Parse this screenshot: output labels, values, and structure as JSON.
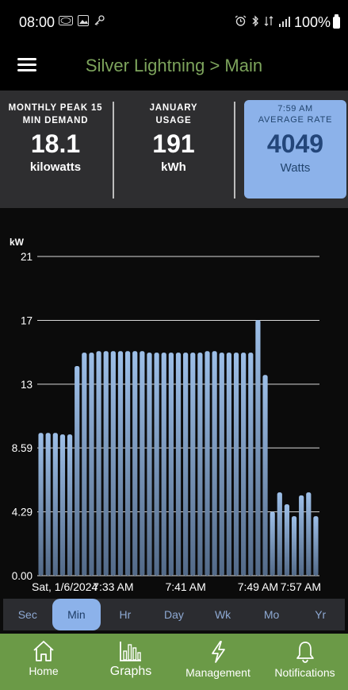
{
  "status_bar": {
    "time": "08:00",
    "battery_text": "100%",
    "left_icons": [
      "ford-notification-icon",
      "image-icon",
      "key-icon"
    ],
    "right_icons": [
      "alarm-icon",
      "bluetooth-icon",
      "data-icon",
      "signal-icon",
      "battery-icon"
    ]
  },
  "app": {
    "title": "Silver Lightning > Main"
  },
  "stats": {
    "peak": {
      "label_line1": "MONTHLY PEAK 15",
      "label_line2": "MIN DEMAND",
      "value": "18.1",
      "unit": "kilowatts"
    },
    "usage": {
      "label_line1": "JANUARY",
      "label_line2": "USAGE",
      "value": "191",
      "unit": "kWh"
    },
    "rate": {
      "time": "7:59 AM",
      "label": "AVERAGE RATE",
      "value": "4049",
      "unit": "Watts"
    }
  },
  "chart_data": {
    "type": "bar",
    "ylabel": "kW",
    "ylim": [
      0,
      21
    ],
    "yticks": [
      "0.00",
      "4.29",
      "8.59",
      "13",
      "17",
      "21"
    ],
    "ytick_values": [
      0,
      4.29,
      8.59,
      12.88,
      17.17,
      21.47
    ],
    "xtick_labels": [
      "Sat, 1/6/2024",
      "7:33 AM",
      "7:41 AM",
      "7:49 AM",
      "7:57 AM"
    ],
    "xtick_positions": [
      0,
      10,
      20,
      30,
      39
    ],
    "values": [
      9.6,
      9.6,
      9.6,
      9.5,
      9.5,
      14.1,
      15.0,
      15.0,
      15.1,
      15.1,
      15.1,
      15.1,
      15.1,
      15.1,
      15.1,
      15.0,
      15.0,
      15.0,
      15.0,
      15.0,
      15.0,
      15.0,
      15.0,
      15.1,
      15.1,
      15.0,
      15.0,
      15.0,
      15.0,
      15.0,
      17.2,
      13.5,
      4.3,
      5.6,
      4.8,
      4.0,
      5.4,
      5.6,
      4.0
    ],
    "bar_color": "#9dbfe8"
  },
  "tabs": {
    "items": [
      "Sec",
      "Min",
      "Hr",
      "Day",
      "Wk",
      "Mo",
      "Yr"
    ],
    "active": "Min"
  },
  "bottom_nav": {
    "items": [
      {
        "label": "Home",
        "icon": "home-icon"
      },
      {
        "label": "Graphs",
        "icon": "bar-chart-icon"
      },
      {
        "label": "Management",
        "icon": "lightning-icon"
      },
      {
        "label": "Notifications",
        "icon": "bell-icon"
      }
    ],
    "active": "Graphs"
  },
  "colors": {
    "accent_green": "#6b9a47",
    "title_green": "#7da45c",
    "highlight_blue": "#8cb2ea"
  }
}
